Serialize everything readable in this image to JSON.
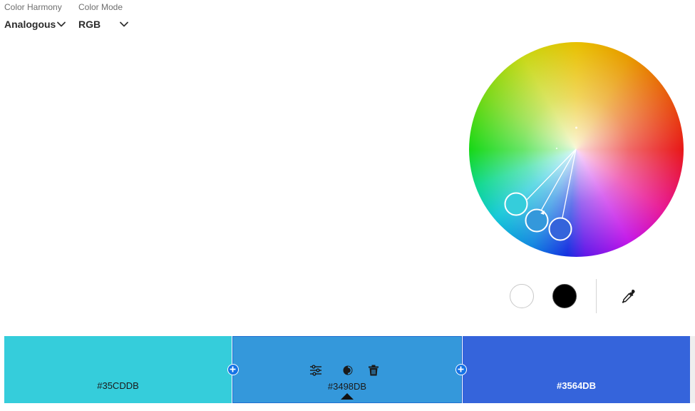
{
  "controls": {
    "harmony": {
      "label": "Color Harmony",
      "value": "Analogous"
    },
    "mode": {
      "label": "Color Mode",
      "value": "RGB"
    }
  },
  "icons": {
    "dropdown": "chevron-down-icon",
    "eyedropper": "eyedropper-icon",
    "adjust": "sliders-icon",
    "contrast": "contrast-icon",
    "delete": "trash-icon",
    "add": "plus-icon"
  },
  "chips": {
    "white": "#FFFFFF",
    "black": "#000000"
  },
  "swatches": [
    {
      "hex": "#35CDDB",
      "color": "#35CDDB",
      "selected": false
    },
    {
      "hex": "#3498DB",
      "color": "#3498DB",
      "selected": true
    },
    {
      "hex": "#3564DB",
      "color": "#3564DB",
      "selected": false
    }
  ],
  "accent": "#1473E6"
}
